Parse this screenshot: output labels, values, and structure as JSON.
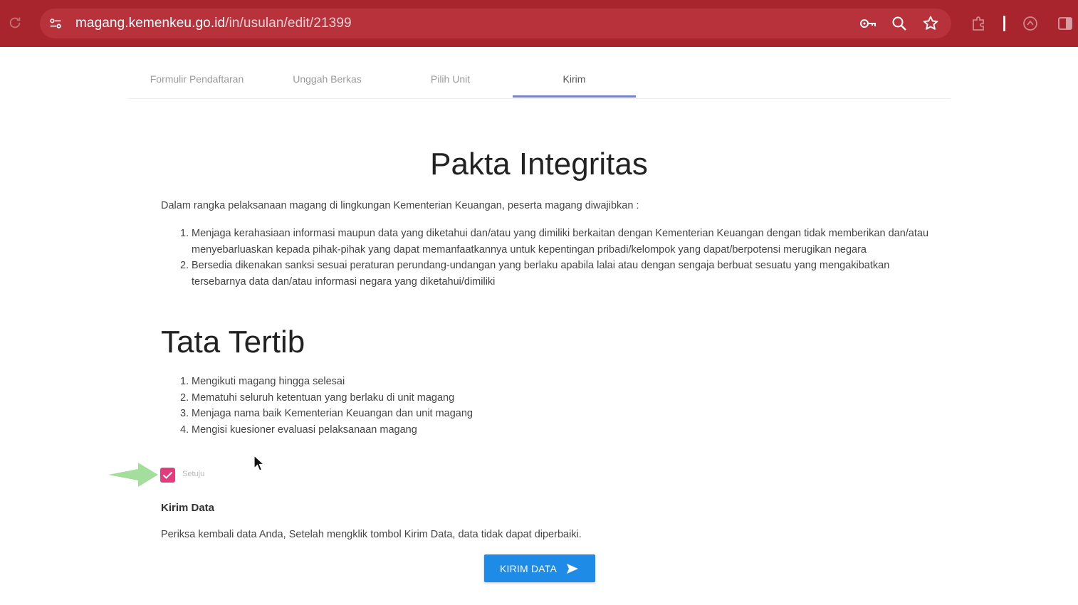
{
  "browser": {
    "url_host": "magang.kemenkeu.go.id",
    "url_path": "/in/usulan/edit/21399",
    "icons": [
      "reload-icon",
      "site-info-icon",
      "password-key-icon",
      "zoom-icon",
      "bookmark-star-icon",
      "extensions-icon",
      "profile-icon",
      "side-panel-icon"
    ]
  },
  "steps": [
    {
      "label": "Formulir Pendaftaran",
      "active": false
    },
    {
      "label": "Unggah Berkas",
      "active": false
    },
    {
      "label": "Pilih Unit",
      "active": false
    },
    {
      "label": "Kirim",
      "active": true
    }
  ],
  "pakta": {
    "title": "Pakta Integritas",
    "intro": "Dalam rangka pelaksanaan magang di lingkungan Kementerian Keuangan, peserta magang diwajibkan :",
    "items": [
      {
        "num": "1.",
        "text": "Menjaga kerahasiaan informasi maupun data yang diketahui dan/atau yang dimiliki berkaitan dengan Kementerian Keuangan dengan tidak memberikan dan/atau menyebarluaskan kepada pihak-pihak yang dapat memanfaatkannya untuk kepentingan pribadi/kelompok yang dapat/berpotensi merugikan negara"
      },
      {
        "num": "2.",
        "text": "Bersedia dikenakan sanksi sesuai peraturan perundang-undangan yang berlaku apabila lalai atau dengan sengaja berbuat sesuatu yang mengakibatkan tersebarnya data dan/atau informasi negara yang diketahui/dimiliki"
      }
    ]
  },
  "tata": {
    "title": "Tata Tertib",
    "items": [
      {
        "num": "1.",
        "text": "Mengikuti magang hingga selesai"
      },
      {
        "num": "2.",
        "text": "Mematuhi seluruh ketentuan yang berlaku di unit magang"
      },
      {
        "num": "3.",
        "text": "Menjaga nama baik Kementerian Keuangan dan unit magang"
      },
      {
        "num": "4.",
        "text": "Mengisi kuesioner evaluasi pelaksanaan magang"
      }
    ]
  },
  "agree": {
    "label": "Setuju",
    "checked": true
  },
  "kirim": {
    "heading": "Kirim Data",
    "text": "Periksa kembali data Anda, Setelah mengklik tombol Kirim Data, data tidak dapat diperbaiki.",
    "button_label": "KIRIM DATA"
  },
  "colors": {
    "browser_bar": "#a8252d",
    "checkbox": "#e23c7a",
    "primary_button": "#1e8be6",
    "active_tab_underline": "#7983c7",
    "hint_arrow": "#9fdc97"
  }
}
